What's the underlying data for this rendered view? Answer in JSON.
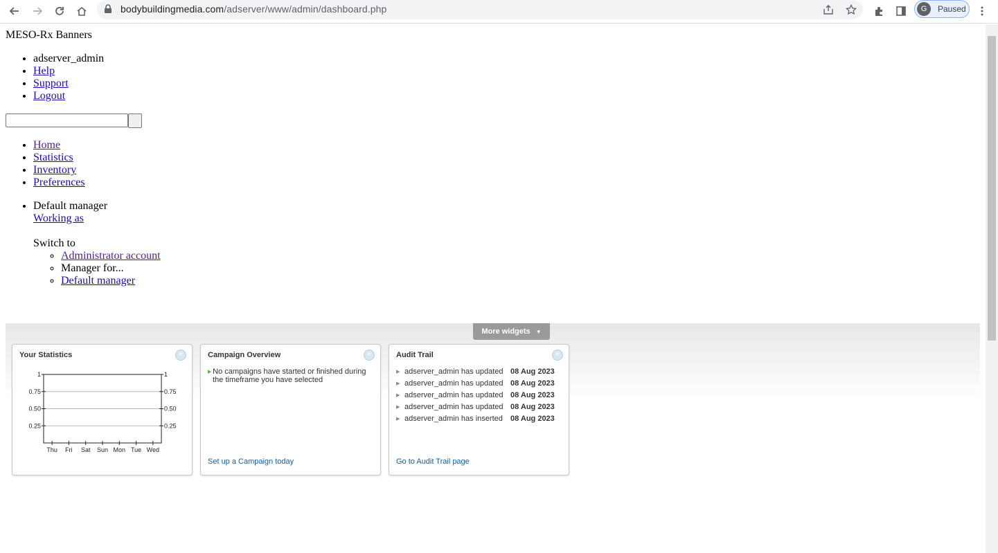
{
  "browser": {
    "url_host": "bodybuildingmedia.com",
    "url_path": "/adserver/www/admin/dashboard.php",
    "profile_initial": "G",
    "profile_status": "Paused"
  },
  "site": {
    "title": "MESO-Rx Banners"
  },
  "user_menu": {
    "username": "adserver_admin",
    "help": "Help",
    "support": "Support",
    "logout": "Logout"
  },
  "main_nav": [
    "Home",
    "Statistics",
    "Inventory",
    "Preferences"
  ],
  "account": {
    "current": "Default manager",
    "working_as": "Working as",
    "switch_to": "Switch to",
    "options": [
      "Administrator account",
      "Manager for...",
      "Default manager"
    ]
  },
  "widgets_bar": {
    "more_widgets": "More widgets"
  },
  "stats_widget": {
    "title": "Your Statistics"
  },
  "campaign_widget": {
    "title": "Campaign Overview",
    "message": "No campaigns have started or finished during the timeframe you have selected",
    "link": "Set up a Campaign today"
  },
  "audit_widget": {
    "title": "Audit Trail",
    "rows": [
      {
        "text": "adserver_admin has updated",
        "date": "08 Aug 2023"
      },
      {
        "text": "adserver_admin has updated",
        "date": "08 Aug 2023"
      },
      {
        "text": "adserver_admin has updated",
        "date": "08 Aug 2023"
      },
      {
        "text": "adserver_admin has updated",
        "date": "08 Aug 2023"
      },
      {
        "text": "adserver_admin has inserted",
        "date": "08 Aug 2023"
      }
    ],
    "link": "Go to Audit Trail page"
  },
  "chart_data": {
    "type": "line",
    "categories": [
      "Thu",
      "Fri",
      "Sat",
      "Sun",
      "Mon",
      "Tue",
      "Wed"
    ],
    "series": [],
    "y_ticks_left": [
      "1",
      "0.75",
      "0.50",
      "0.25"
    ],
    "y_ticks_right": [
      "1",
      "0.75",
      "0.50",
      "0.25"
    ],
    "ylim": [
      0,
      1
    ],
    "grid": true
  },
  "colors": {
    "link": "#1a0dab",
    "visited_link": "#551a8b",
    "widget_link": "#1c5a8d",
    "more_widgets_bg": "#9a9a9a",
    "bullet_green": "#6aa84f"
  }
}
